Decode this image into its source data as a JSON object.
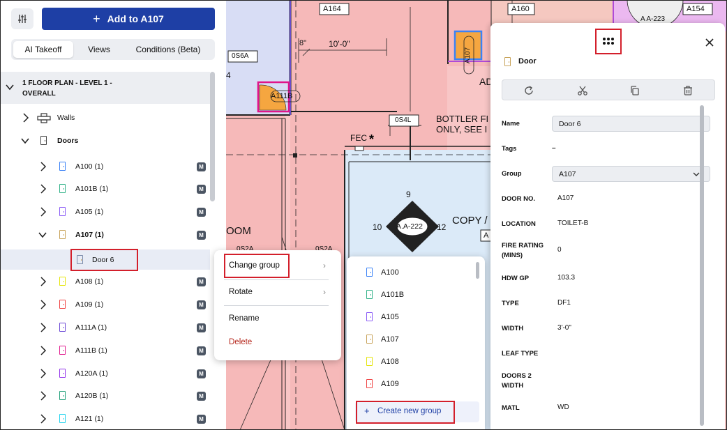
{
  "sidebar": {
    "add_button_label": "Add to A107",
    "tabs": [
      {
        "label": "AI Takeoff",
        "active": true
      },
      {
        "label": "Views",
        "active": false
      },
      {
        "label": "Conditions (Beta)",
        "active": false
      }
    ],
    "floor_title": "1 FLOOR PLAN - LEVEL 1 - OVERALL",
    "walls_label": "Walls",
    "doors_label": "Doors",
    "badge_label": "M",
    "groups": [
      {
        "label": "A100 (1)",
        "color": "#3b82f6",
        "expanded": false
      },
      {
        "label": "A101B (1)",
        "color": "#34b38a",
        "expanded": false
      },
      {
        "label": "A105 (1)",
        "color": "#8b5cf6",
        "expanded": false
      },
      {
        "label": "A107 (1)",
        "color": "#c8a35a",
        "expanded": true
      },
      {
        "label": "A108 (1)",
        "color": "#e5e50c",
        "expanded": false
      },
      {
        "label": "A109 (1)",
        "color": "#ef4444",
        "expanded": false
      },
      {
        "label": "A111A (1)",
        "color": "#6d4bd6",
        "expanded": false
      },
      {
        "label": "A111B (1)",
        "color": "#e11d8f",
        "expanded": false
      },
      {
        "label": "A120A (1)",
        "color": "#9333ea",
        "expanded": false
      },
      {
        "label": "A120B (1)",
        "color": "#22a07a",
        "expanded": false
      },
      {
        "label": "A121 (1)",
        "color": "#22d3ee",
        "expanded": false
      }
    ],
    "selected_item": "Door 6"
  },
  "blueprint": {
    "texts": {
      "a164": "A164",
      "a160": "A160",
      "a154": "A154",
      "aa223": "A A-223",
      "dim_8": "8\"",
      "dim_10": "10'-0\"",
      "tag_0s6a": "0S6A",
      "tag_0s4l": "0S4L",
      "door_a111b": "A111B",
      "door_a107": "A107",
      "ad": "AD",
      "bottler_1": "BOTTLER FI",
      "bottler_2": "ONLY, SEE I",
      "fec": "FEC",
      "num_4": "4",
      "oom": "OOM",
      "num_9": "9",
      "num_10": "10",
      "num_12": "12",
      "aa222": "A.A-222",
      "copy": "COPY /",
      "a_small": "A",
      "tag_0s2a_1": "0S2A",
      "tag_0s2a_2": "0S2A"
    }
  },
  "context_menu": {
    "change_group": "Change group",
    "rotate": "Rotate",
    "rename": "Rename",
    "delete": "Delete"
  },
  "group_menu": {
    "items": [
      {
        "label": "A100",
        "color": "#3b82f6"
      },
      {
        "label": "A101B",
        "color": "#34b38a"
      },
      {
        "label": "A105",
        "color": "#8b5cf6"
      },
      {
        "label": "A107",
        "color": "#c8a35a"
      },
      {
        "label": "A108",
        "color": "#e5e50c"
      },
      {
        "label": "A109",
        "color": "#ef4444"
      }
    ],
    "create_label": "Create new group"
  },
  "details": {
    "title": "Door",
    "name_label": "Name",
    "name_value": "Door 6",
    "tags_label": "Tags",
    "tags_value": "–",
    "group_label": "Group",
    "group_value": "A107",
    "properties": [
      {
        "label": "DOOR NO.",
        "value": "A107"
      },
      {
        "label": "LOCATION",
        "value": "TOILET-B"
      },
      {
        "label": "FIRE RATING (MINS)",
        "value": "0"
      },
      {
        "label": "HDW GP",
        "value": "103.3"
      },
      {
        "label": "TYPE",
        "value": "DF1"
      },
      {
        "label": "WIDTH",
        "value": "3'-0\""
      },
      {
        "label": "LEAF TYPE",
        "value": ""
      },
      {
        "label": "DOORS 2 WIDTH",
        "value": ""
      },
      {
        "label": "MATL",
        "value": "WD"
      }
    ]
  },
  "colors": {
    "primary": "#1e3fa5",
    "highlight_red": "#d31f2b",
    "delete_red": "#b42318",
    "blueprint_pink": "#f8c6c6"
  }
}
